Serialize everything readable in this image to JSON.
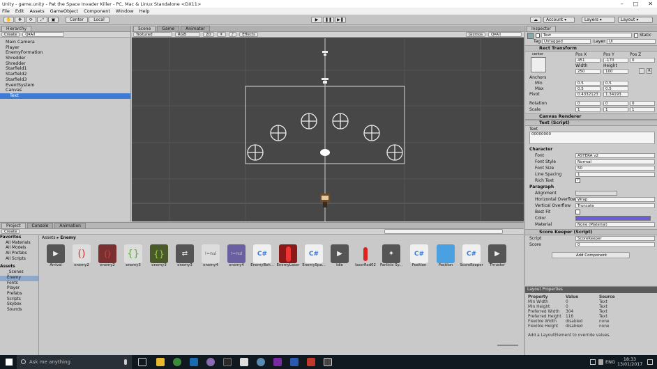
{
  "window_title": "Unity - game.unity - Pat the Space Invader Killer - PC, Mac & Linux Standalone <DX11>",
  "menu": [
    "File",
    "Edit",
    "Assets",
    "GameObject",
    "Component",
    "Window",
    "Help"
  ],
  "toolbar": {
    "center": "Center",
    "local": "Local",
    "layers": "Layers",
    "layout": "Layout"
  },
  "hierarchy": {
    "title": "Hierarchy",
    "create": "Create",
    "search": "Q▾All",
    "items": [
      "Main Camera",
      "Player",
      "EnemyFormation",
      "Shredder",
      "Shredder",
      "Starfield1",
      "Starfield2",
      "Starfield3",
      "EventSystem",
      "Canvas",
      "Text"
    ]
  },
  "scene": {
    "tabs": [
      "Scene",
      "Game",
      "Animator"
    ],
    "shading": "Textured",
    "rgb": "RGB",
    "mode2d": "2D",
    "effects": "Effects",
    "gizmos": "Gizmos",
    "search": "Q▾All"
  },
  "inspector": {
    "title": "Inspector",
    "object_name": "Text",
    "static": "Static",
    "tag_label": "Tag",
    "tag": "Untagged",
    "layer_label": "Layer",
    "layer": "UI",
    "rect_transform": "Rect Transform",
    "anchor_preset": "center",
    "pos_x_label": "Pos X",
    "pos_y_label": "Pos Y",
    "pos_z_label": "Pos Z",
    "pos_x": "451",
    "pos_y": "-170",
    "pos_z": "0",
    "width_label": "Width",
    "height_label": "Height",
    "width": "250",
    "height": "100",
    "anchors": "Anchors",
    "min": "Min",
    "max": "Max",
    "pivot": "Pivot",
    "min_x": "0.5",
    "min_y": "0.5",
    "max_x": "0.5",
    "max_y": "0.5",
    "pivot_x": "0.4332123",
    "pivot_y": "1.34193",
    "rotation": "Rotation",
    "rot_x": "0",
    "rot_y": "0",
    "rot_z": "0",
    "scale": "Scale",
    "scale_x": "1",
    "scale_y": "1",
    "scale_z": "1",
    "canvas_renderer": "Canvas Renderer",
    "text_script": "Text (Script)",
    "text_label": "Text",
    "text_value": "00000000",
    "character": "Character",
    "font": "Font",
    "font_value": "ASTERA v2",
    "font_style": "Font Style",
    "font_style_value": "Normal",
    "font_size": "Font Size",
    "font_size_value": "50",
    "line_spacing": "Line Spacing",
    "line_spacing_value": "1",
    "rich_text": "Rich Text",
    "paragraph": "Paragraph",
    "alignment": "Alignment",
    "h_overflow": "Horizontal Overflow",
    "h_overflow_value": "Wrap",
    "v_overflow": "Vertical Overflow",
    "v_overflow_value": "Truncate",
    "best_fit": "Best Fit",
    "color": "Color",
    "color_value": "#6a5fd8",
    "material": "Material",
    "material_value": "None (Material)",
    "score_keeper": "Score Keeper (Script)",
    "script_label": "Script",
    "script_value": "ScoreKeeper",
    "score_label": "Score",
    "score_value": "0",
    "add_component": "Add Component"
  },
  "project": {
    "tabs": [
      "Project",
      "Console",
      "Animation"
    ],
    "create": "Create",
    "breadcrumb": [
      "Assets",
      "Enemy"
    ],
    "favorites": "Favorites",
    "fav_items": [
      "All Materials",
      "All Models",
      "All Prefabs",
      "All Scripts"
    ],
    "assets_label": "Assets",
    "folders": [
      "_Scenes",
      "Enemy",
      "Fonts",
      "Player",
      "Prefabs",
      "Scripts",
      "Skybox",
      "Sounds"
    ],
    "items": [
      "Arrival",
      "enemy2",
      "enemy2",
      "enemy3",
      "enemy3",
      "enemy3",
      "enemy4",
      "enemy4",
      "EnemyBeh...",
      "EnemyLaser",
      "EnemySpa...",
      "Idle",
      "laserRed02",
      "Particle Sy...",
      "Position",
      "Position",
      "ScoreKeeper",
      "Thruster"
    ]
  },
  "layout_props": {
    "title": "Layout Properties",
    "headers": [
      "Property",
      "Value",
      "Source"
    ],
    "rows": [
      [
        "Min Width",
        "0",
        "Text"
      ],
      [
        "Min Height",
        "0",
        "Text"
      ],
      [
        "Preferred Width",
        "304",
        "Text"
      ],
      [
        "Preferred Height",
        "116",
        "Text"
      ],
      [
        "Flexible Width",
        "disabled",
        "none"
      ],
      [
        "Flexible Height",
        "disabled",
        "none"
      ]
    ],
    "hint": "Add a LayoutElement to override values."
  },
  "taskbar": {
    "search": "Ask me anything",
    "time": "18:33",
    "date": "13/01/2017",
    "lang": "ENG"
  }
}
